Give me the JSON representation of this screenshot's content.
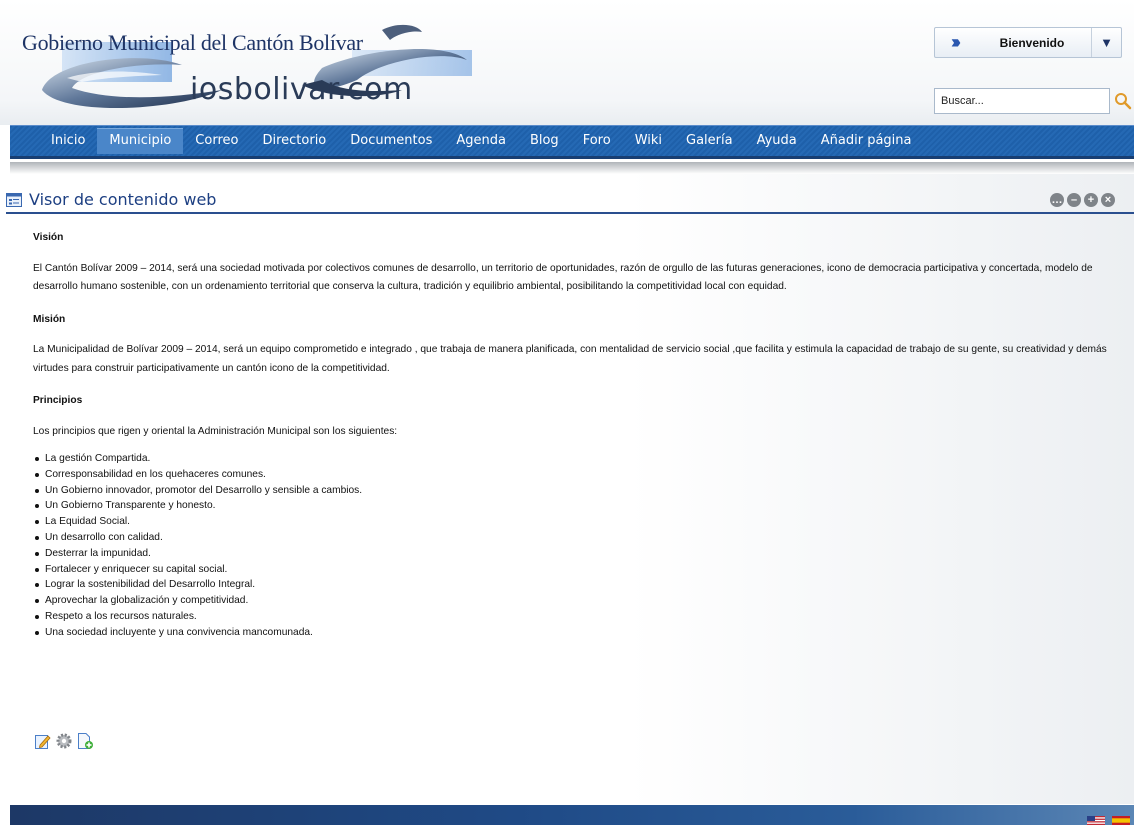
{
  "header": {
    "site_title": "Gobierno Municipal del Cantón Bolívar",
    "logo_text": "iosbolivar.com",
    "welcome_label": "Bienvenido",
    "search_placeholder": "Buscar..."
  },
  "nav": {
    "items": [
      {
        "label": "Inicio"
      },
      {
        "label": "Municipio",
        "active": true
      },
      {
        "label": "Correo"
      },
      {
        "label": "Directorio"
      },
      {
        "label": "Documentos"
      },
      {
        "label": "Agenda"
      },
      {
        "label": "Blog"
      },
      {
        "label": "Foro"
      },
      {
        "label": "Wiki"
      },
      {
        "label": "Galería"
      },
      {
        "label": "Ayuda"
      },
      {
        "label": "Añadir página"
      }
    ]
  },
  "portlet": {
    "title": "Visor de contenido web",
    "controls": [
      "options-icon",
      "minimize-icon",
      "maximize-icon",
      "close-icon"
    ],
    "vision_heading": "Visión",
    "vision_text": "El Cantón Bolívar 2009 – 2014, será una sociedad motivada por colectivos comunes de desarrollo, un territorio de oportunidades, razón de orgullo de las futuras generaciones, icono  de democracia participativa y concertada, modelo de desarrollo humano  sostenible, con un ordenamiento territorial que conserva la cultura, tradición y equilibrio ambiental, posibilitando la competitividad local con equidad.",
    "mision_heading": "Misión",
    "mision_text": "La Municipalidad de Bolívar 2009 – 2014, será un equipo  comprometido e integrado , que trabaja de manera planificada, con mentalidad de servicio social ,que facilita y estimula la capacidad de trabajo de su gente, su creatividad y demás virtudes para construir participativamente un cantón icono de la competitividad.",
    "principios_heading": "Principios",
    "principios_intro": "Los principios que rigen y oriental la Administración  Municipal son los siguientes:",
    "principios": [
      "La gestión Compartida.",
      "Corresponsabilidad en los quehaceres comunes.",
      "Un Gobierno innovador, promotor del Desarrollo  y sensible a cambios.",
      "Un Gobierno Transparente y honesto.",
      "La Equidad Social.",
      "Un desarrollo con calidad.",
      "Desterrar la impunidad.",
      "Fortalecer y enriquecer su capital social.",
      "Lograr la sostenibilidad del Desarrollo Integral.",
      "Aprovechar la globalización y competitividad.",
      "Respeto a los recursos naturales.",
      "Una sociedad incluyente y una convivencia mancomunada."
    ],
    "action_icons": [
      "edit-icon",
      "configuration-icon",
      "add-page-icon"
    ]
  },
  "footer": {
    "languages": [
      "english-flag-icon",
      "spanish-flag-icon"
    ]
  }
}
